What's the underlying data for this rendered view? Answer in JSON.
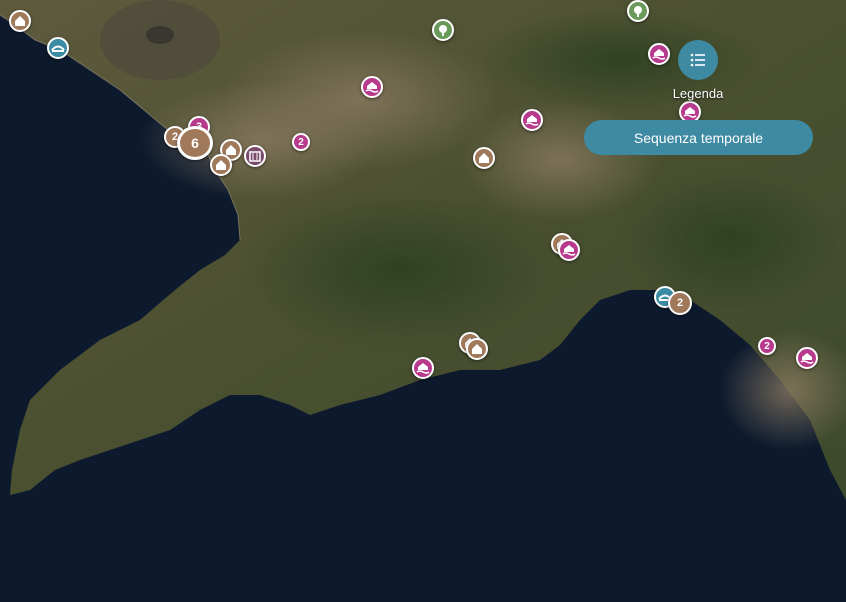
{
  "controls": {
    "legend_label": "Legenda",
    "timeline_label": "Sequenza temporale"
  },
  "colors": {
    "sea": "#0d1a2e",
    "marker_brown": "#a0785a",
    "marker_magenta": "#b83a8c",
    "marker_teal": "#3b8ba5",
    "marker_green": "#6a9a5a",
    "marker_purple": "#7a4a6a",
    "button": "#3e8aa3"
  },
  "clusters": {
    "c1": "2",
    "c2": "3",
    "c3": "6",
    "c4": "2",
    "c5": "2",
    "c6": "2"
  }
}
